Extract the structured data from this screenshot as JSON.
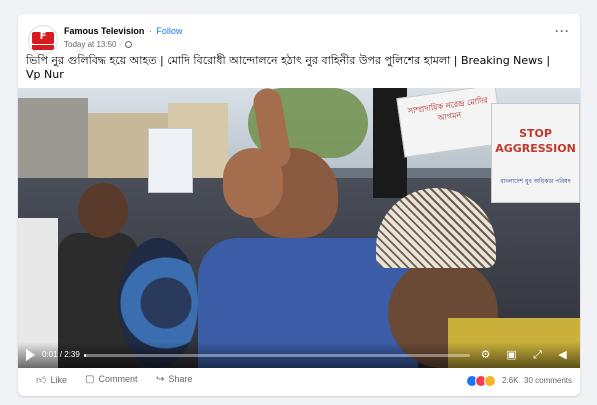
{
  "post": {
    "page_name": "Famous Television",
    "separator": "·",
    "follow_label": "Follow",
    "timestamp": "Today at 13:50",
    "separator_meta": "·",
    "text": "ভিপি নুর গুলিবিদ্ধ হয়ে আহত | মোদি বিরোধী আন্দোলনে হঠাৎ নুর বাহিনীর উপর পুলিশের হামলা | Breaking News | Vp Nur",
    "avatar_letter": "F"
  },
  "video": {
    "time": "0:01 / 2:39",
    "progress": 0.006,
    "signs": {
      "stop": "STOP AGGRESSION",
      "stop_sub": "বাংলাদেশ যুব অধিকার পরিষদ",
      "bengali": "সাম্প্রদায়িক নরেন্দ্র মোদির আগমন"
    }
  },
  "actions": {
    "like": "Like",
    "comment": "Comment",
    "share": "Share",
    "reaction_count": "2.6K",
    "comments_count": "30 comments"
  },
  "colors": {
    "link": "#1877f2",
    "like_reaction": "#1877f2",
    "love_reaction": "#f33e58",
    "haha_reaction": "#f7b125"
  }
}
